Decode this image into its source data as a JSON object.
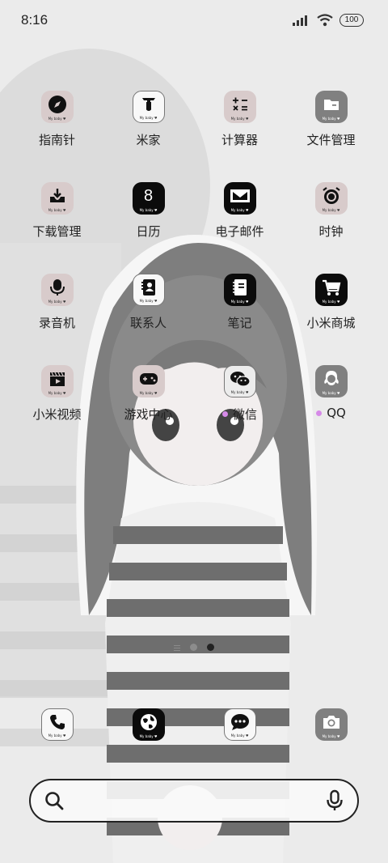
{
  "status_bar": {
    "time": "8:16",
    "battery": "100",
    "icons": [
      "signal-icon",
      "wifi-icon",
      "battery-icon"
    ]
  },
  "apps": [
    {
      "id": "compass",
      "label": "指南针",
      "style": "pink",
      "icon": "compass-icon",
      "badge": "My baby ♥"
    },
    {
      "id": "mijia",
      "label": "米家",
      "style": "white",
      "icon": "mijia-icon",
      "badge": "My baby ♥"
    },
    {
      "id": "calculator",
      "label": "计算器",
      "style": "pink",
      "icon": "calculator-icon",
      "badge": "My baby ♥"
    },
    {
      "id": "file-manager",
      "label": "文件管理",
      "style": "gray",
      "icon": "folder-icon",
      "badge": "My baby ♥"
    },
    {
      "id": "downloads",
      "label": "下载管理",
      "style": "pink",
      "icon": "download-icon",
      "badge": "My baby ♥"
    },
    {
      "id": "calendar",
      "label": "日历",
      "style": "black",
      "icon": "calendar-icon",
      "badge": "My baby ♥",
      "glyph": "8"
    },
    {
      "id": "email",
      "label": "电子邮件",
      "style": "black",
      "icon": "mail-icon",
      "badge": "My baby ♥"
    },
    {
      "id": "clock",
      "label": "时钟",
      "style": "pink",
      "icon": "alarm-clock-icon",
      "badge": "My baby ♥"
    },
    {
      "id": "recorder",
      "label": "录音机",
      "style": "pink",
      "icon": "microphone-icon",
      "badge": "My baby ♥"
    },
    {
      "id": "contacts",
      "label": "联系人",
      "style": "white",
      "icon": "contacts-icon",
      "badge": "My baby ♥"
    },
    {
      "id": "notes",
      "label": "笔记",
      "style": "black",
      "icon": "notebook-icon",
      "badge": "My baby ♥"
    },
    {
      "id": "mi-store",
      "label": "小米商城",
      "style": "black",
      "icon": "shopping-cart-icon",
      "badge": "My baby ♥"
    },
    {
      "id": "mi-video",
      "label": "小米视频",
      "style": "pink",
      "icon": "video-icon",
      "badge": "My baby ♥"
    },
    {
      "id": "game-center",
      "label": "游戏中心",
      "style": "pink",
      "icon": "gamepad-icon",
      "badge": "My baby ♥"
    },
    {
      "id": "wechat",
      "label": "微信",
      "style": "light",
      "icon": "wechat-icon",
      "badge": "My baby ♥",
      "new_dot": true
    },
    {
      "id": "qq",
      "label": "QQ",
      "style": "gray",
      "icon": "qq-penguin-icon",
      "badge": "My baby ♥",
      "new_dot": true
    }
  ],
  "page_indicator": {
    "pages": 2,
    "active": 2
  },
  "dock": [
    {
      "id": "phone",
      "style": "white",
      "icon": "phone-icon",
      "badge": "My baby ♥"
    },
    {
      "id": "browser",
      "style": "black",
      "icon": "globe-icon",
      "badge": "My baby ♥"
    },
    {
      "id": "messages",
      "style": "white",
      "icon": "chat-bubble-icon",
      "badge": "My baby ♥"
    },
    {
      "id": "camera",
      "style": "gray",
      "icon": "camera-icon",
      "badge": "My baby ♥"
    }
  ],
  "search": {
    "icons": [
      "search-icon",
      "microphone-icon"
    ]
  },
  "colors": {
    "notification_dot": "#d68ae8",
    "tile_pink": "#d8cbcb",
    "tile_black": "#0b0b0b",
    "tile_gray": "#808080"
  }
}
